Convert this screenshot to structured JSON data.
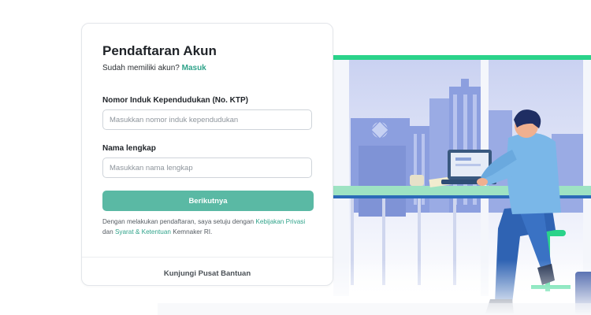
{
  "form": {
    "title": "Pendaftaran Akun",
    "have_account_text": "Sudah memiliki akun?",
    "login_link": "Masuk",
    "nik_label": "Nomor Induk Kependudukan (No. KTP)",
    "nik_placeholder": "Masukkan nomor induk kependudukan",
    "nik_value": "",
    "name_label": "Nama lengkap",
    "name_placeholder": "Masukkan nama lengkap",
    "name_value": "",
    "submit_label": "Berikutnya",
    "terms_prefix": "Dengan melakukan pendaftaran, saya setuju dengan",
    "privacy_link": "Kebijakan Privasi",
    "terms_and": "dan",
    "terms_link": "Syarat & Ketentuan",
    "terms_suffix": "Kemnaker RI.",
    "help_link": "Kunjungi Pusat Bantuan"
  },
  "colors": {
    "accent": "#2fa38a",
    "button": "#5ab9a4",
    "illustration_green": "#2ad38a",
    "illustration_blue": "#8fa3e0"
  },
  "icons": {
    "illustration": "person-working-on-laptop-illustration"
  }
}
